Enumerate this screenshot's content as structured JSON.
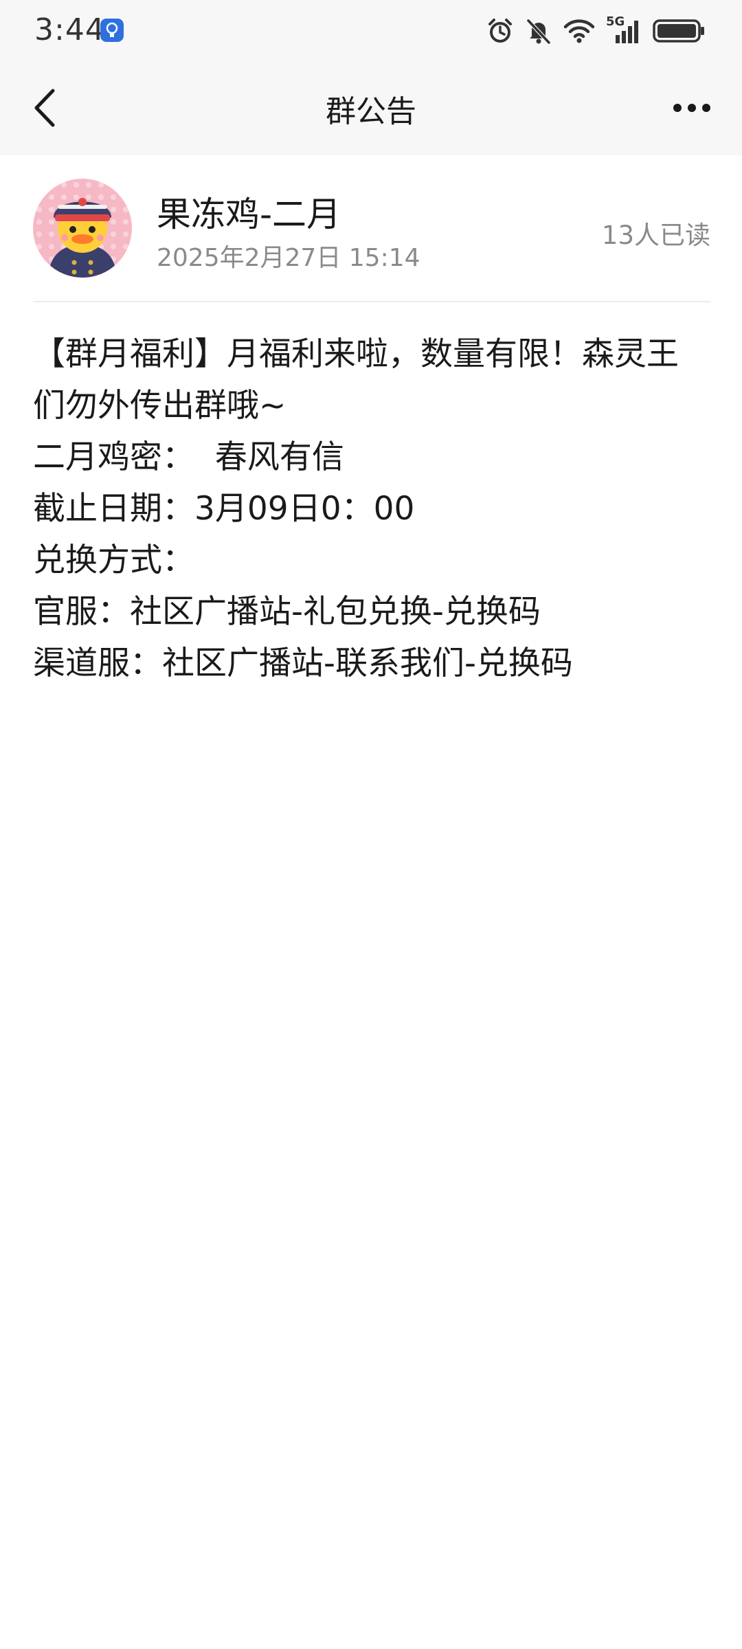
{
  "status_bar": {
    "time": "3:44",
    "icons": [
      "alarm-icon",
      "bell-muted-icon",
      "wifi-icon",
      "signal-5g-icon",
      "battery-icon"
    ],
    "network_label": "5G"
  },
  "nav": {
    "title": "群公告",
    "back_icon": "chevron-left-icon",
    "more_icon": "more-dots-icon"
  },
  "post": {
    "author": "果冻鸡-二月",
    "time": "2025年2月27日 15:14",
    "read_count": "13人已读",
    "lines": [
      "【群月福利】月福利来啦，数量有限！森灵王们勿外传出群哦~",
      "二月鸡密：  春风有信",
      "截止日期：3月09日0：00",
      "兑换方式：",
      "官服：社区广播站-礼包兑换-兑换码",
      "渠道服：社区广播站-联系我们-兑换码"
    ]
  },
  "colors": {
    "bar_background": "#f7f7f7",
    "text_primary": "#1a1a1a",
    "text_secondary": "#8a8a8a",
    "status_app_icon": "#2f6fe0"
  }
}
